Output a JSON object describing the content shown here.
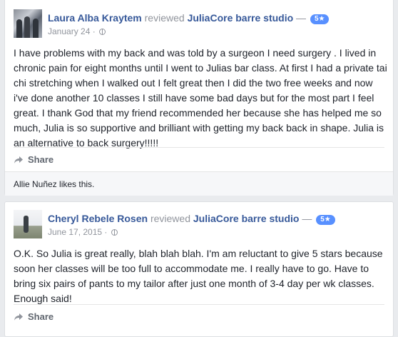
{
  "reviews": [
    {
      "reviewer": "Laura Alba Kraytem",
      "verb": "reviewed",
      "page": "JuliaCore barre studio",
      "separator": "—",
      "rating": "5★",
      "date": "January 24 ·",
      "text": "I have problems with my back and was told by a surgeon I need surgery . I lived in chronic pain for eight months until I went to Julias bar class. At first I had a private tai chi stretching when I walked out I felt great then I did the two free weeks and now i've done another 10 classes I still have some bad days but for the most part I feel great. I thank God that my friend recommended her because she has helped me so much, Julia is so supportive and brilliant with getting my back back in shape. Julia is an alternative to back surgery!!!!!",
      "share_label": "Share",
      "likes": "Allie Nuñez likes this."
    },
    {
      "reviewer": "Cheryl Rebele Rosen",
      "verb": "reviewed",
      "page": "JuliaCore barre studio",
      "separator": "—",
      "rating": "5★",
      "date": "June 17, 2015 ·",
      "text": "O.K. So Julia is great really, blah blah blah. I'm am reluctant to give 5 stars because soon her classes will be too full to accommodate me. I really have to go. Have to bring six pairs of pants to my tailor after just one month of 3-4 day per wk classes. Enough said!",
      "share_label": "Share"
    }
  ],
  "icons": {
    "privacy": "globe-icon",
    "share": "share-arrow-icon"
  },
  "colors": {
    "link": "#365899",
    "badge": "#5890ff",
    "muted": "#90949c"
  }
}
